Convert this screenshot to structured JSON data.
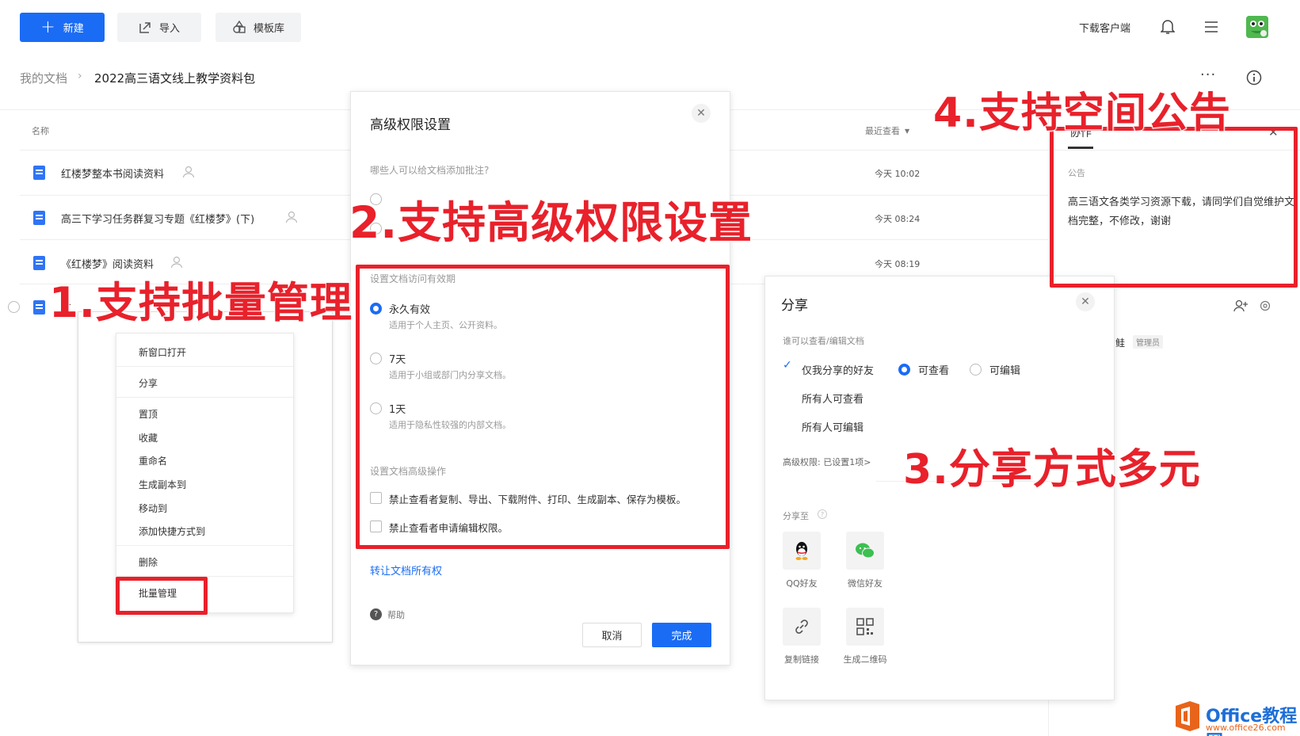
{
  "toolbar": {
    "new_label": "新建",
    "import_label": "导入",
    "template_label": "模板库",
    "download_client": "下载客户端"
  },
  "breadcrumb": {
    "root": "我的文档",
    "current": "2022高三语文线上教学资料包"
  },
  "list": {
    "col_name": "名称",
    "col_recent": "最近查看",
    "files": [
      {
        "name": "红楼梦整本书阅读资料",
        "time": "今天 10:02"
      },
      {
        "name": "高三下学习任务群复习专题《红楼梦》(下)",
        "time": "今天 08:24"
      },
      {
        "name": "《红楼梦》阅读资料",
        "time": "今天 08:19"
      },
      {
        "name": "红"
      }
    ]
  },
  "context_menu": {
    "items": [
      "新窗口打开",
      "分享",
      "置顶",
      "收藏",
      "重命名",
      "生成副本到",
      "移动到",
      "添加快捷方式到",
      "删除",
      "批量管理"
    ]
  },
  "perm_dialog": {
    "title": "高级权限设置",
    "comment_question": "哪些人可以给文档添加批注?",
    "validity_header": "设置文档访问有效期",
    "options": [
      {
        "label": "永久有效",
        "sub": "适用于个人主页、公开资料。"
      },
      {
        "label": "7天",
        "sub": "适用于小组或部门内分享文档。"
      },
      {
        "label": "1天",
        "sub": "适用于隐私性较强的内部文档。"
      }
    ],
    "advanced_header": "设置文档高级操作",
    "checks": [
      "禁止查看者复制、导出、下载附件、打印、生成副本、保存为模板。",
      "禁止查看者申请编辑权限。"
    ],
    "transfer_link": "转让文档所有权",
    "help": "帮助",
    "cancel": "取消",
    "done": "完成"
  },
  "share_dialog": {
    "title": "分享",
    "who_label": "谁可以查看/编辑文档",
    "opt_friends": "仅我分享的好友",
    "perm_view": "可查看",
    "perm_edit": "可编辑",
    "opt_all_view": "所有人可查看",
    "opt_all_edit": "所有人可编辑",
    "advanced": "高级权限: 已设置1项>",
    "share_to": "分享至",
    "targets": [
      "QQ好友",
      "微信好友",
      "复制链接",
      "生成二维码"
    ]
  },
  "side_panel": {
    "tab": "协作",
    "notice_label": "公告",
    "notice_text": "高三语文各类学习资源下载，请同学们自觉维护文档完整，不修改，谢谢",
    "member_fragment": "鲑",
    "role_badge": "管理员"
  },
  "annotations": {
    "a1": "1.支持批量管理",
    "a2": "2.支持高级权限设置",
    "a3": "3.分享方式多元",
    "a4": "4.支持空间公告"
  },
  "watermark": {
    "title": "Office教程网",
    "url": "www.office26.com"
  },
  "colors": {
    "accent": "#1a6cf5",
    "annotation_red": "#e8212b"
  }
}
